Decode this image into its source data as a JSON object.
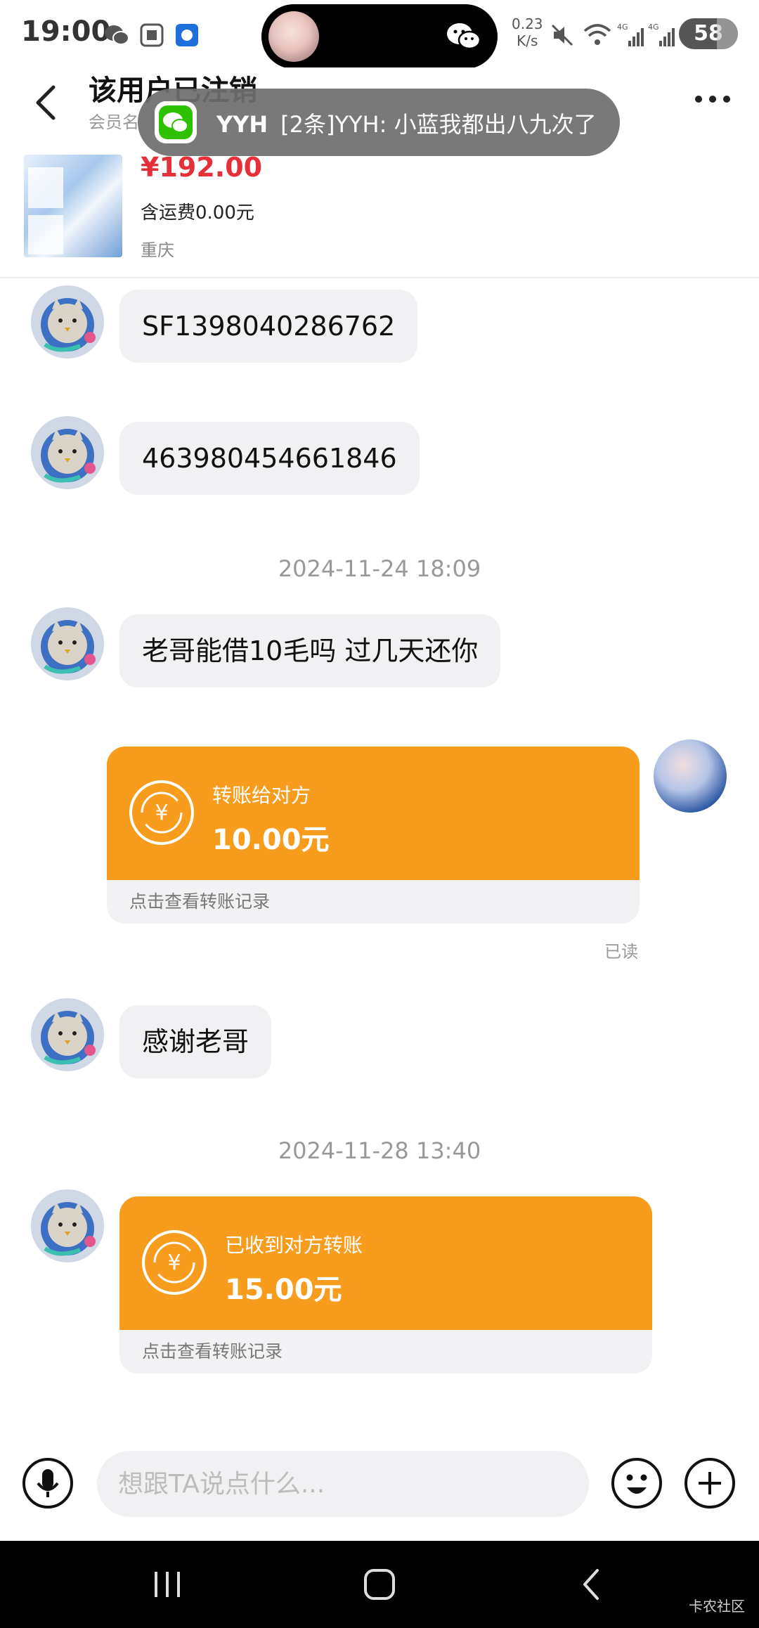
{
  "status_bar": {
    "time": "19:00",
    "net_speed": "0.23",
    "net_speed_unit": "K/s",
    "battery": "58"
  },
  "header": {
    "title": "该用户已注销",
    "subtitle": "会员名",
    "product": {
      "price": "¥192.00",
      "shipping": "含运费0.00元",
      "location": "重庆"
    }
  },
  "notification": {
    "sender": "YYH",
    "text": "[2条]YYH: 小蓝我都出八九次了"
  },
  "messages": {
    "m1": "SF1398040286762",
    "m2": "463980454661846",
    "ts1": "2024-11-24 18:09",
    "m3": "老哥能借10毛吗 过几天还你",
    "transfer_sent": {
      "label": "转账给对方",
      "amount": "10.00元",
      "footer": "点击查看转账记录",
      "status": "已读"
    },
    "m4": "感谢老哥",
    "ts2": "2024-11-28 13:40",
    "transfer_received": {
      "label": "已收到对方转账",
      "amount": "15.00元",
      "footer": "点击查看转账记录"
    }
  },
  "input": {
    "placeholder": "想跟TA说点什么..."
  },
  "watermark": "卡农社区",
  "colors": {
    "price_red": "#e5303a",
    "transfer_orange": "#f89c1d",
    "bubble_gray": "#f1f1f3"
  }
}
